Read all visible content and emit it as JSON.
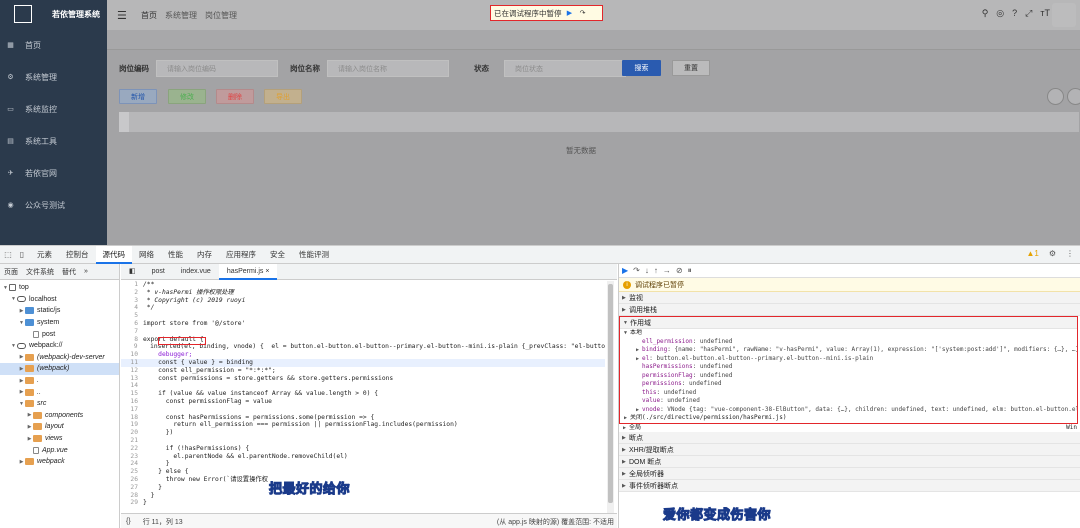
{
  "app": {
    "title": "若依管理系统",
    "menu": [
      {
        "icon": "dashboard-icon",
        "glyph": "▦",
        "label": "首页"
      },
      {
        "icon": "system-icon",
        "glyph": "⚙",
        "label": "系统管理"
      },
      {
        "icon": "monitor-icon",
        "glyph": "▭",
        "label": "系统监控"
      },
      {
        "icon": "tool-icon",
        "glyph": "▤",
        "label": "系统工具"
      },
      {
        "icon": "guide-icon",
        "glyph": "✈",
        "label": "若依官网"
      },
      {
        "icon": "link-icon",
        "glyph": "◉",
        "label": "公众号测试"
      }
    ],
    "breadcrumb": [
      "首页",
      "系统管理",
      "岗位管理"
    ],
    "debug_banner": "已在调试程序中暂停",
    "search": {
      "code_label": "岗位编码",
      "code_placeholder": "请输入岗位编码",
      "name_label": "岗位名称",
      "name_placeholder": "请输入岗位名称",
      "status_label": "状态",
      "status_placeholder": "岗位状态",
      "search_btn": "搜索",
      "reset_btn": "重置"
    },
    "actions": {
      "add": "新增",
      "edit": "修改",
      "delete": "删除",
      "export": "导出"
    },
    "empty": "暂无数据"
  },
  "devtools": {
    "tabs": [
      "元素",
      "控制台",
      "源代码",
      "网络",
      "性能",
      "内存",
      "应用程序",
      "安全",
      "性能评测"
    ],
    "active_tab": "源代码",
    "warn_count": "1",
    "nav_tabs": [
      "页面",
      "文件系统",
      "替代",
      "»"
    ],
    "tree": [
      {
        "label": "top",
        "depth": 0,
        "arrow": "▼",
        "icon": "page"
      },
      {
        "label": "localhost",
        "depth": 1,
        "arrow": "▼",
        "icon": "cloud"
      },
      {
        "label": "static/js",
        "depth": 2,
        "arrow": "▶",
        "icon": "folder-b"
      },
      {
        "label": "system",
        "depth": 2,
        "arrow": "▼",
        "icon": "folder-b"
      },
      {
        "label": "post",
        "depth": 3,
        "arrow": "",
        "icon": "file"
      },
      {
        "label": "webpack://",
        "depth": 1,
        "arrow": "▼",
        "icon": "cloud"
      },
      {
        "label": "(webpack)-dev-server",
        "depth": 2,
        "arrow": "▶",
        "icon": "folder-o",
        "italic": true
      },
      {
        "label": "(webpack)",
        "depth": 2,
        "arrow": "▶",
        "icon": "folder-o",
        "italic": true,
        "selected": true
      },
      {
        "label": ".",
        "depth": 2,
        "arrow": "▶",
        "icon": "folder-o",
        "italic": true
      },
      {
        "label": "..",
        "depth": 2,
        "arrow": "▶",
        "icon": "folder-o",
        "italic": true
      },
      {
        "label": "src",
        "depth": 2,
        "arrow": "▼",
        "icon": "folder-o",
        "italic": true
      },
      {
        "label": "components",
        "depth": 3,
        "arrow": "▶",
        "icon": "folder-o",
        "italic": true
      },
      {
        "label": "layout",
        "depth": 3,
        "arrow": "▶",
        "icon": "folder-o",
        "italic": true
      },
      {
        "label": "views",
        "depth": 3,
        "arrow": "▶",
        "icon": "folder-o",
        "italic": true
      },
      {
        "label": "App.vue",
        "depth": 3,
        "arrow": "",
        "icon": "file",
        "italic": true
      },
      {
        "label": "webpack",
        "depth": 2,
        "arrow": "▶",
        "icon": "folder-o",
        "italic": true
      }
    ],
    "editor_tabs": [
      "post",
      "index.vue",
      "hasPermi.js"
    ],
    "active_editor_tab": "hasPermi.js",
    "status_left": "行 11，列 13",
    "status_right": "(从 app.js 映射的源) 覆盖范围: 不适用",
    "subtitle_left": "把最好的给你",
    "subtitle_right": "爱你都变成伤害你",
    "paused_text": "调试程序已暂停",
    "sections_top": [
      "监视",
      "调用堆栈"
    ],
    "scope_title": "作用域",
    "local_title": "本地",
    "scope_vars": [
      {
        "k": "ell_permission",
        "v": "undefined",
        "arrow": false
      },
      {
        "k": "binding",
        "v": "{name: \"hasPermi\", rawName: \"v-hasPermi\", value: Array(1), expression: \"['system:post:add']\", modifiers: {…}, …}",
        "arrow": true
      },
      {
        "k": "el",
        "v": "button.el-button.el-button--primary.el-button--mini.is-plain",
        "arrow": true
      },
      {
        "k": "hasPermissions",
        "v": "undefined",
        "arrow": false
      },
      {
        "k": "permissionFlag",
        "v": "undefined",
        "arrow": false
      },
      {
        "k": "permissions",
        "v": "undefined",
        "arrow": false
      },
      {
        "k": "this",
        "v": "undefined",
        "arrow": false
      },
      {
        "k": "value",
        "v": "undefined",
        "arrow": false
      },
      {
        "k": "vnode",
        "v": "VNode {tag: \"vue-component-38-ElButton\", data: {…}, children: undefined, text: undefined, elm: button.el-button.el-button…",
        "arrow": true
      }
    ],
    "closure": "关闭(./src/directive/permission/hasPermi.js)",
    "global": "全局",
    "global_right": "Win",
    "sections_bottom": [
      "断点",
      "XHR/提取断点",
      "DOM 断点",
      "全局侦听器",
      "事件侦听器断点"
    ]
  },
  "code_lines": [
    {
      "n": "1",
      "t": "/**",
      "c": "cm"
    },
    {
      "n": "2",
      "t": " * v-hasPermi 操作权限处理",
      "c": "cm"
    },
    {
      "n": "3",
      "t": " * Copyright (c) 2019 ruoyi",
      "c": "cm"
    },
    {
      "n": "4",
      "t": " */",
      "c": "cm"
    },
    {
      "n": "5",
      "t": "",
      "c": ""
    },
    {
      "n": "6",
      "t": "import store from '@/store'",
      "c": "imp"
    },
    {
      "n": "7",
      "t": "",
      "c": ""
    },
    {
      "n": "8",
      "t": "export default {",
      "c": "kw"
    },
    {
      "n": "9",
      "t": "  inserted(el, binding, vnode) {  el = button.el-button.el-button--primary.el-button--mini.is-plain {_prevClass: \"el-butto",
      "c": "ins"
    },
    {
      "n": "10",
      "t": "    debugger;",
      "c": "deb"
    },
    {
      "n": "11",
      "t": "    const { value } = binding",
      "c": "cur"
    },
    {
      "n": "12",
      "t": "    const ell_permission = \"*:*:*\";",
      "c": ""
    },
    {
      "n": "13",
      "t": "    const permissions = store.getters && store.getters.permissions",
      "c": ""
    },
    {
      "n": "14",
      "t": "",
      "c": ""
    },
    {
      "n": "15",
      "t": "    if (value && value instanceof Array && value.length > 0) {",
      "c": ""
    },
    {
      "n": "16",
      "t": "      const permissionFlag = value",
      "c": ""
    },
    {
      "n": "17",
      "t": "",
      "c": ""
    },
    {
      "n": "18",
      "t": "      const hasPermissions = permissions.some(permission => {",
      "c": ""
    },
    {
      "n": "19",
      "t": "        return ell_permission === permission || permissionFlag.includes(permission)",
      "c": ""
    },
    {
      "n": "20",
      "t": "      })",
      "c": ""
    },
    {
      "n": "21",
      "t": "",
      "c": ""
    },
    {
      "n": "22",
      "t": "      if (!hasPermissions) {",
      "c": ""
    },
    {
      "n": "23",
      "t": "        el.parentNode && el.parentNode.removeChild(el)",
      "c": ""
    },
    {
      "n": "24",
      "t": "      }",
      "c": ""
    },
    {
      "n": "25",
      "t": "    } else {",
      "c": ""
    },
    {
      "n": "26",
      "t": "      throw new Error(`请设置操作权",
      "c": ""
    },
    {
      "n": "27",
      "t": "    }",
      "c": ""
    },
    {
      "n": "28",
      "t": "  }",
      "c": ""
    },
    {
      "n": "29",
      "t": "}",
      "c": ""
    }
  ]
}
